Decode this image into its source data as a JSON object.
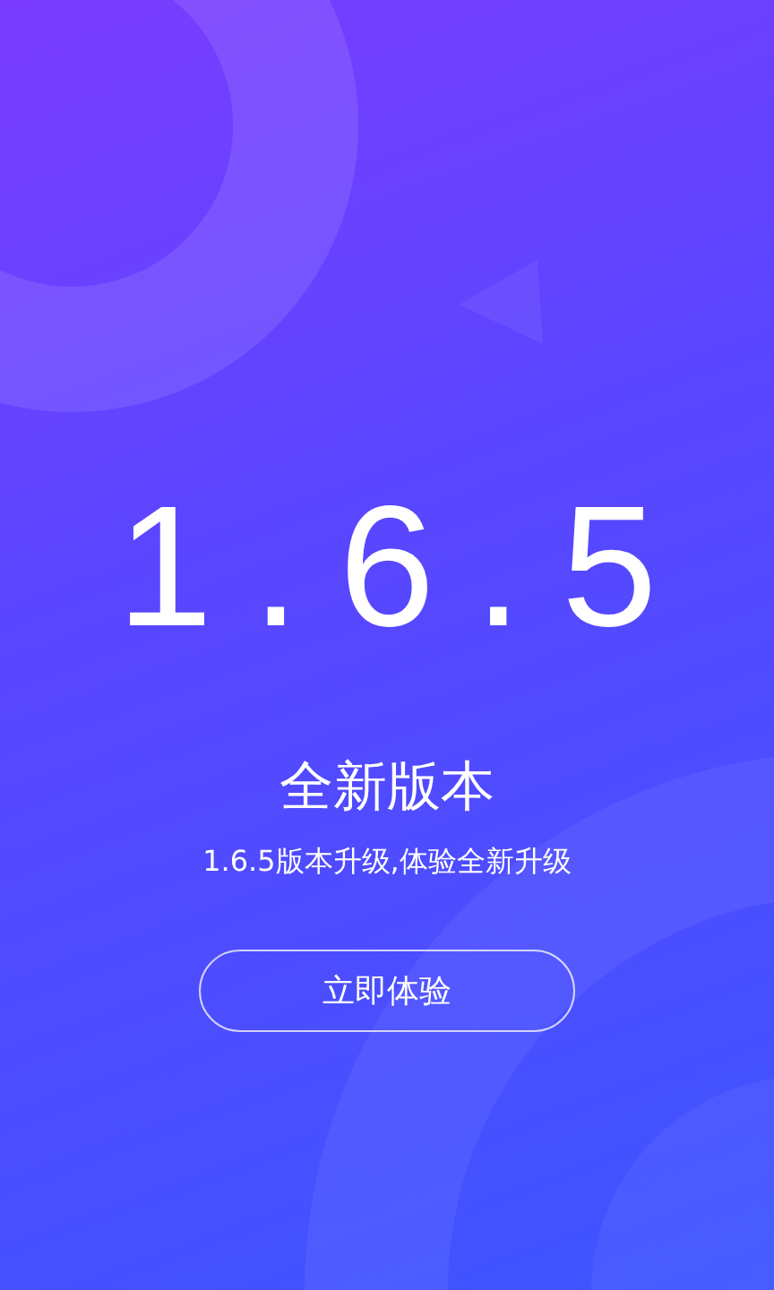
{
  "version": "1.6.5",
  "title": "全新版本",
  "subtitle": "1.6.5版本升级,体验全新升级",
  "button": {
    "label": "立即体验"
  }
}
